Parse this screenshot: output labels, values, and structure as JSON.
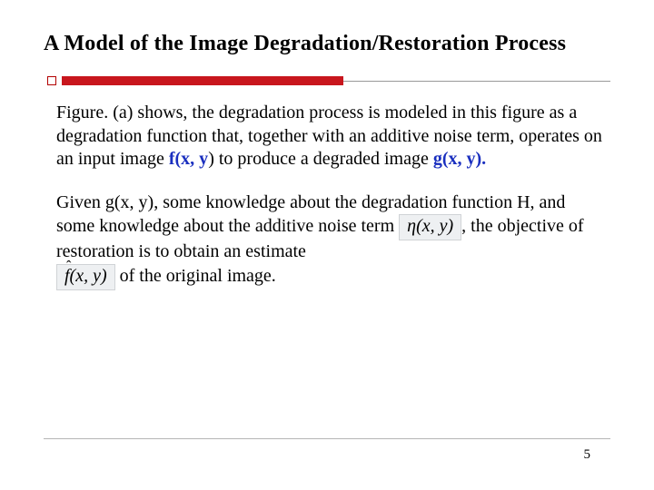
{
  "title": "A Model of the Image Degradation/Restoration Process",
  "para1_a": "Figure. (a) shows, the degradation process is modeled in this figure as a degradation function that, together with an additive noise term, operates on an input  image ",
  "fxy": "f(x, y",
  "para1_b": ") to produce a degraded image ",
  "gxy": "g(x, y).",
  "para2_a": "Given g(x, y), some knowledge about the degradation function H, and some knowledge about the additive noise term ",
  "eta": "η(x, y)",
  "para2_b": ",  the objective of restoration is to obtain an estimate ",
  "fhat": "f(x, y)",
  "para2_c": " of the original image.",
  "page_number": "5"
}
